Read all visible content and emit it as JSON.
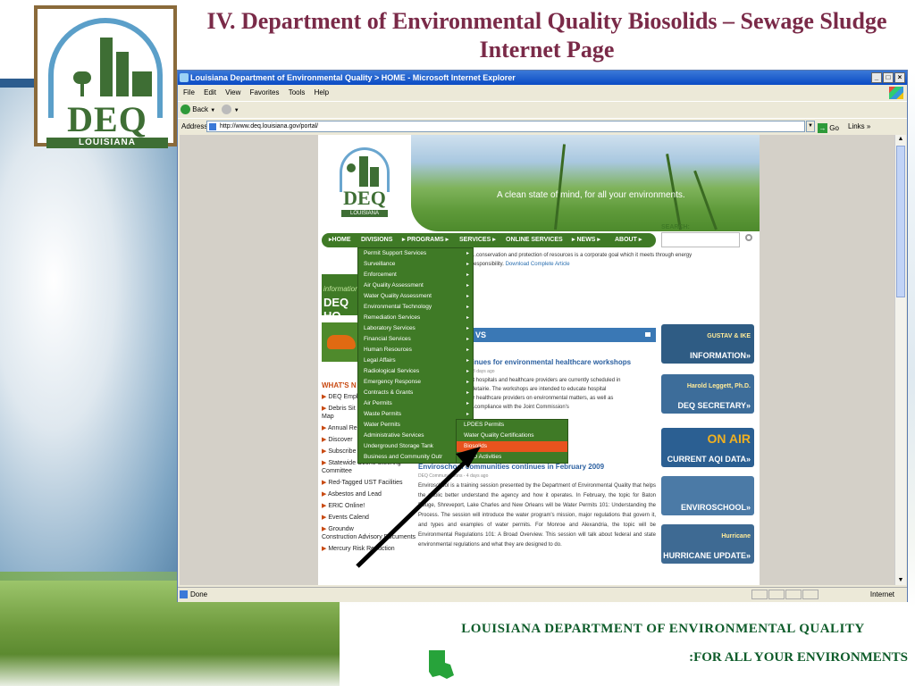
{
  "slide": {
    "title": "IV. Department of Environmental Quality Biosolids – Sewage Sludge Internet Page",
    "logo_text": "DEQ",
    "logo_sub": "LOUISIANA",
    "footer_title": "LOUISIANA DEPARTMENT OF ENVIRONMENTAL QUALITY",
    "footer_tagline": ":FOR ALL YOUR ENVIRONMENTS",
    "colors": {
      "title": "#7a2a48",
      "footer": "#0e5c2a",
      "logo_green": "#3e6e34"
    }
  },
  "browser": {
    "window_title": "Louisiana Department of Environmental Quality > HOME - Microsoft Internet Explorer",
    "menu": [
      "File",
      "Edit",
      "View",
      "Favorites",
      "Tools",
      "Help"
    ],
    "back_label": "Back",
    "address_label": "Address",
    "url": "http://www.deq.louisiana.gov/portal/",
    "go_label": "Go",
    "links_label": "Links",
    "status_text": "Done",
    "zone_text": "Internet"
  },
  "site": {
    "logo_text": "DEQ",
    "logo_sub": "LOUISIANA",
    "tagline": "A clean state of mind, for all your environments.",
    "nav": [
      "HOME",
      "DIVISIONS",
      "PROGRAMS",
      "SERVICES",
      "ONLINE SERVICES",
      "NEWS",
      "ABOUT"
    ],
    "search_label": "SEARCH:",
    "article_lines": [
      "...conservation and protection of resources is a corporate goal which it meets through energy",
      "responsibility.",
      "Download Complete Article"
    ],
    "info_banner_top": "information",
    "info_banner_main": "DEQ HO",
    "whats_new_heading": "WHAT'S N",
    "whats_new": [
      "DEQ Empl",
      "Debris Sit",
      "Map",
      "Annual Re",
      "Discover",
      "Subscribe",
      "Statewide Ozone Steering Committee",
      "Red-Tagged UST Facilities",
      "Asbestos and Lead",
      "ERIC Online!",
      "Events Calend",
      "Groundw",
      "Construction Advisory Documents",
      "Mercury Risk Reduction"
    ],
    "news_heading": "VS",
    "news1_title": "tinues for environmental healthcare workshops",
    "news1_date": "- 3 days ago",
    "news1_lines": [
      "at hospitals and healthcare providers are currently scheduled in",
      "Metairie. The workshops are intended to educate hospital",
      "er healthcare providers on environmental matters, as well as",
      "...compliance with the Joint Commission's"
    ],
    "news2_title": "Enviroschool communities continues in February 2009",
    "news2_date": "DEQ Communications - 4 days ago",
    "news2_body": "Enviroschool is a training session presented by the Department of Environmental Quality that helps the public better understand the agency and how it operates. In February, the topic for Baton Rouge, Shreveport, Lake Charles and New Orleans will be Water Permits 101: Understanding the Process. The session will introduce the water program's mission, major regulations that govern it, and types and examples of water permits. For Monroe and Alexandria, the topic will be Environmental Regulations 101: A Broad Overview. This session will talk about federal and state environmental regulations and what they are designed to do.",
    "right_banners": [
      {
        "sub": "GUSTAV & IKE",
        "main": "INFORMATION»",
        "color": "#2f5c84"
      },
      {
        "sub": "Harold Leggett, Ph.D.",
        "main": "DEQ SECRETARY»",
        "color": "#3d6d9a"
      },
      {
        "sub": "ON AIR",
        "main": "CURRENT AQI DATA»",
        "color": "#2b5f92"
      },
      {
        "sub": "",
        "main": "ENVIROSCHOOL»",
        "color": "#4b7aa6"
      },
      {
        "sub": "Hurricane",
        "main": "HURRICANE UPDATE»",
        "color": "#3e6a93"
      }
    ],
    "divisions_menu": [
      "Permit Support Services",
      "Surveillance",
      "Enforcement",
      "Air Quality Assessment",
      "Water Quality Assessment",
      "Environmental Technology",
      "Remediation Services",
      "Laboratory Services",
      "Financial Services",
      "Human Resources",
      "Legal Affairs",
      "Radiological Services",
      "Emergency Response",
      "Contracts & Grants",
      "Air Permits",
      "Waste Permits",
      "Water Permits",
      "Administrative Services",
      "Underground Storage Tank",
      "Business and Community Outr"
    ],
    "water_permits_menu": [
      "LPDES Permits",
      "Water Quality Certifications",
      "Biosolids",
      "WPD Activities"
    ],
    "active_submenu_item": "Biosolids",
    "colors": {
      "nav_green": "#3f7a26",
      "active_orange": "#e8531e",
      "news_blue": "#3a78b5"
    }
  }
}
